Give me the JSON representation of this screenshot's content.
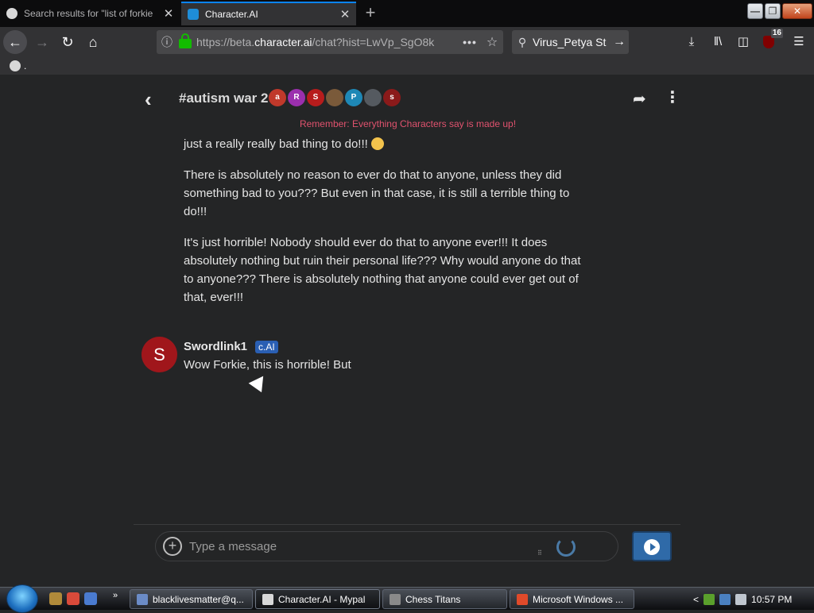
{
  "browser": {
    "tabs": [
      {
        "title": "Search results for \"list of forkie",
        "active": false
      },
      {
        "title": "Character.AI",
        "active": true
      }
    ],
    "new_tab_glyph": "+",
    "window_buttons": {
      "minimize": "—",
      "restore": "❐",
      "close": "✕"
    },
    "url": {
      "prefix": "https://beta.",
      "domain": "character.ai",
      "path": "/chat?hist=LwVp_SgO8k"
    },
    "search_value": "Virus_Petya St",
    "ublock_badge": "16",
    "bookmark_label": "."
  },
  "chat": {
    "title": "#autism war 2",
    "participants": [
      {
        "initial": "a",
        "color": "#c0392b"
      },
      {
        "initial": "R",
        "color": "#9b2fae"
      },
      {
        "initial": "S",
        "color": "#b71c1c"
      },
      {
        "initial": "",
        "color": "#7a5a3a"
      },
      {
        "initial": "P",
        "color": "#1e88b6"
      },
      {
        "initial": "",
        "color": "#555a60"
      },
      {
        "initial": "s",
        "color": "#8b1a1a"
      }
    ],
    "disclaimer": "Remember: Everything Characters say is made up!",
    "previous_message": {
      "paragraphs": [
        "just a really really bad thing to do!!!",
        "There is absolutely no reason to ever do that to anyone, unless they did something bad to you??? But even in that case, it is still a terrible thing to do!!!",
        "It's just horrible! Nobody should ever do that to anyone ever!!! It does absolutely nothing but ruin their personal life??? Why would anyone do that to anyone??? There is absolutely nothing that anyone could ever get out of that, ever!!!"
      ]
    },
    "latest_message": {
      "avatar_initial": "S",
      "author": "Swordlink1",
      "badge": "c.AI",
      "text": "Wow Forkie, this is horrible! But"
    },
    "composer": {
      "placeholder": "Type a message",
      "add_glyph": "+"
    }
  },
  "taskbar": {
    "quick_launch_more": "»",
    "tasks": [
      {
        "label": "blacklivesmatter@q...",
        "icon_color": "#6b8cc7",
        "active": false
      },
      {
        "label": "Character.AI - Mypal",
        "icon_color": "#d8d8d8",
        "active": true
      },
      {
        "label": "Chess Titans",
        "icon_color": "#8a8a8a",
        "active": false
      },
      {
        "label": "Microsoft Windows ...",
        "icon_color": "#e04a2a",
        "active": false
      }
    ],
    "tray_arrow": "<",
    "clock": "10:57 PM"
  },
  "colors": {
    "page_bg": "#242526",
    "disclaimer": "#e0526e",
    "send_button": "#2f6aa8",
    "badge": "#2a5fb3",
    "author_avatar": "#a0161b"
  }
}
